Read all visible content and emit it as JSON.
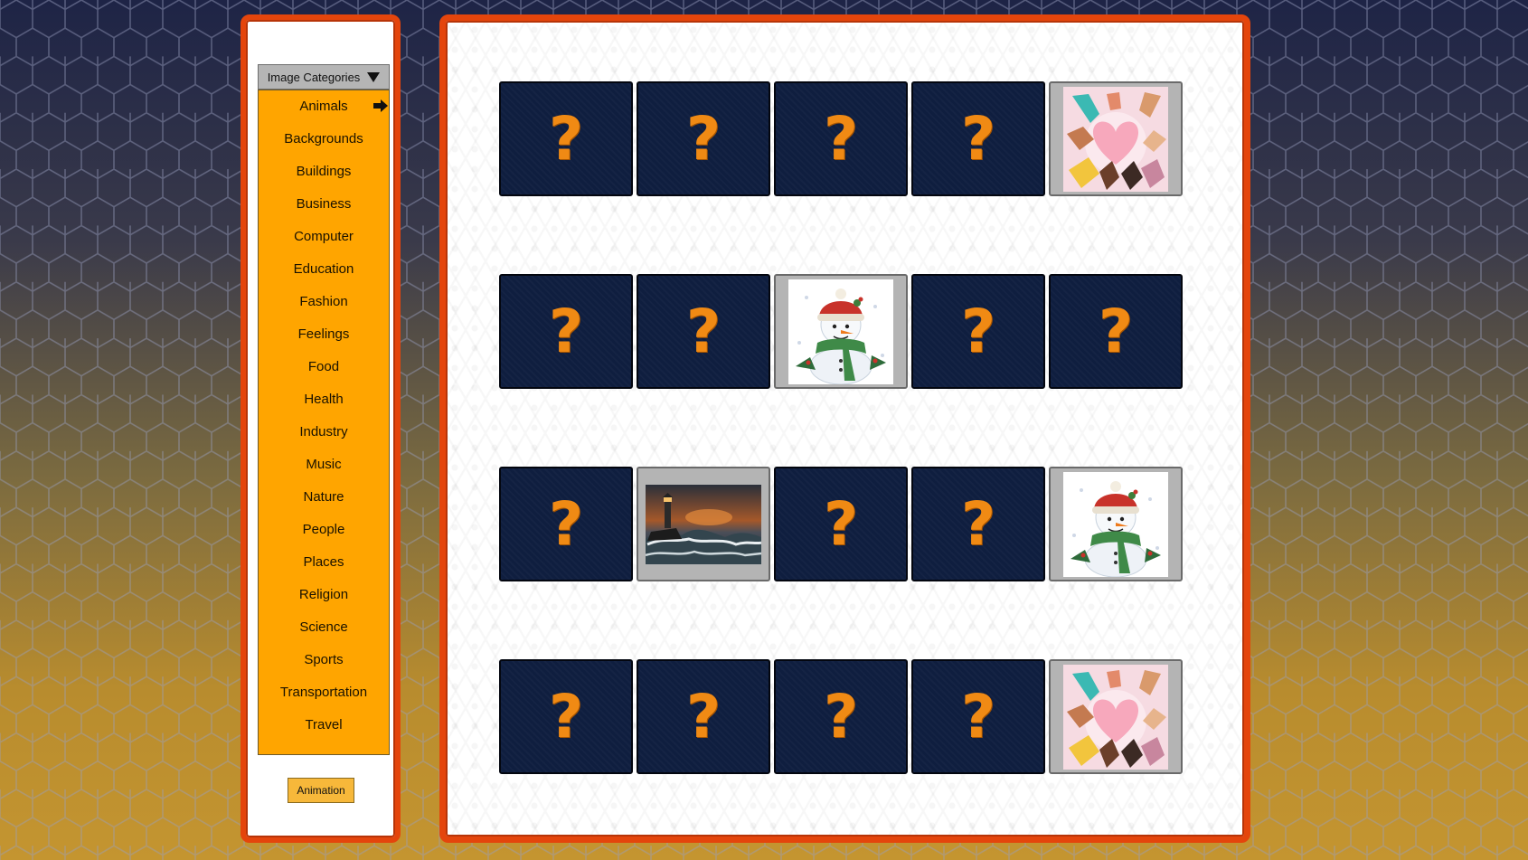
{
  "sidebar": {
    "dropdown_label": "Image Categories",
    "categories": [
      "Animals",
      "Backgrounds",
      "Buildings",
      "Business",
      "Computer",
      "Education",
      "Fashion",
      "Feelings",
      "Food",
      "Health",
      "Industry",
      "Music",
      "Nature",
      "People",
      "Places",
      "Religion",
      "Science",
      "Sports",
      "Transportation",
      "Travel"
    ],
    "selected_category": "Animals",
    "animation_button": "Animation"
  },
  "board": {
    "card_back_symbol": "?",
    "cards": [
      [
        "hidden",
        "hidden",
        "hidden",
        "hidden",
        "hands-heart"
      ],
      [
        "hidden",
        "hidden",
        "snowman",
        "hidden",
        "hidden"
      ],
      [
        "hidden",
        "lighthouse-storm",
        "hidden",
        "hidden",
        "snowman"
      ],
      [
        "hidden",
        "hidden",
        "hidden",
        "hidden",
        "hands-heart"
      ]
    ]
  },
  "colors": {
    "frame": "#e4450c",
    "category_bg": "#ffa500",
    "card_back": "#0f1e3f",
    "question_mark": "#f08a14"
  }
}
